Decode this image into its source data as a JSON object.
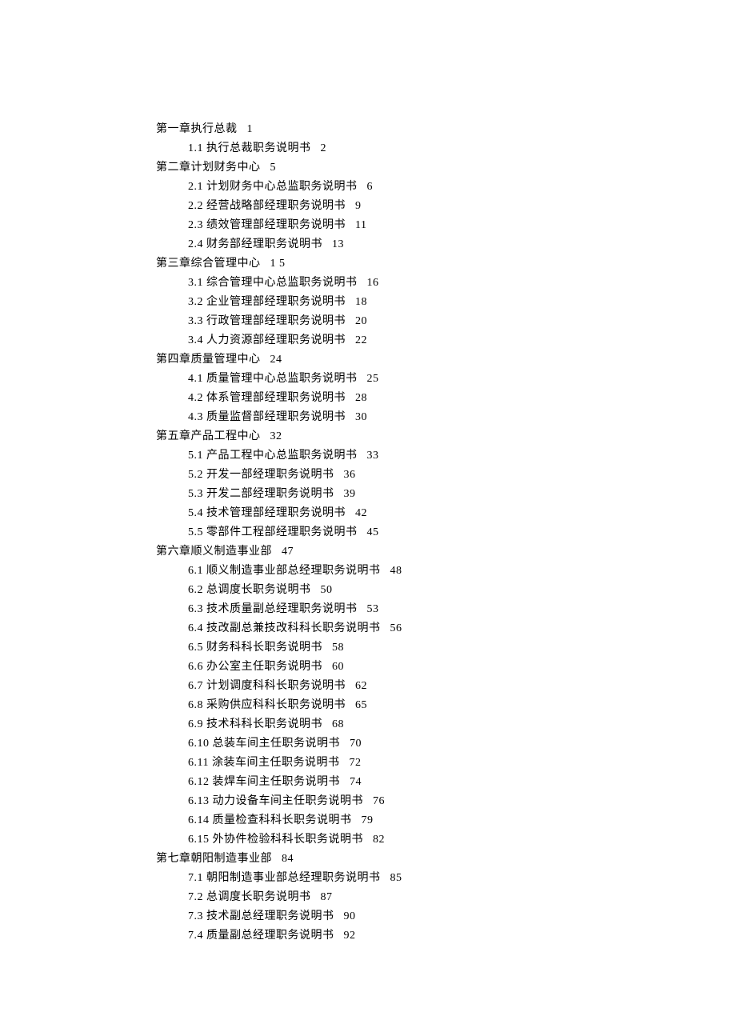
{
  "toc": [
    {
      "type": "chapter",
      "title": "第一章执行总裁",
      "page": "1"
    },
    {
      "type": "section",
      "num": "1.1",
      "title": "执行总裁职务说明书",
      "page": "2"
    },
    {
      "type": "chapter",
      "title": "第二章计划财务中心",
      "page": "5"
    },
    {
      "type": "section",
      "num": "2.1",
      "title": "计划财务中心总监职务说明书",
      "page": "6"
    },
    {
      "type": "section",
      "num": "2.2",
      "title": "经营战略部经理职务说明书",
      "page": "9"
    },
    {
      "type": "section",
      "num": "2.3",
      "title": "绩效管理部经理职务说明书",
      "page": "11"
    },
    {
      "type": "section",
      "num": "2.4",
      "title": "财务部经理职务说明书",
      "page": "13"
    },
    {
      "type": "chapter",
      "title": "第三章综合管理中心",
      "page": "1 5"
    },
    {
      "type": "section",
      "num": "3.1",
      "title": "综合管理中心总监职务说明书",
      "page": "16"
    },
    {
      "type": "section",
      "num": "3.2",
      "title": "企业管理部经理职务说明书",
      "page": "18"
    },
    {
      "type": "section",
      "num": "3.3",
      "title": "行政管理部经理职务说明书",
      "page": "20"
    },
    {
      "type": "section",
      "num": "3.4",
      "title": "人力资源部经理职务说明书",
      "page": "22"
    },
    {
      "type": "chapter",
      "title": "第四章质量管理中心",
      "page": "24"
    },
    {
      "type": "section",
      "num": "4.1",
      "title": "质量管理中心总监职务说明书",
      "page": "25"
    },
    {
      "type": "section",
      "num": "4.2",
      "title": "体系管理部经理职务说明书",
      "page": "28"
    },
    {
      "type": "section",
      "num": "4.3",
      "title": "质量监督部经理职务说明书",
      "page": "30"
    },
    {
      "type": "chapter",
      "title": "第五章产品工程中心",
      "page": "32"
    },
    {
      "type": "section",
      "num": "5.1",
      "title": "产品工程中心总监职务说明书",
      "page": "33"
    },
    {
      "type": "section",
      "num": "5.2",
      "title": "开发一部经理职务说明书",
      "page": "36"
    },
    {
      "type": "section",
      "num": "5.3",
      "title": "开发二部经理职务说明书",
      "page": "39"
    },
    {
      "type": "section",
      "num": "5.4",
      "title": "技术管理部经理职务说明书",
      "page": "42"
    },
    {
      "type": "section",
      "num": "5.5",
      "title": "零部件工程部经理职务说明书",
      "page": "45"
    },
    {
      "type": "chapter",
      "title": "第六章顺义制造事业部",
      "page": "47"
    },
    {
      "type": "section",
      "num": "6.1",
      "title": "顺义制造事业部总经理职务说明书",
      "page": "48"
    },
    {
      "type": "section",
      "num": "6.2",
      "title": "总调度长职务说明书",
      "page": "50"
    },
    {
      "type": "section",
      "num": "6.3",
      "title": "技术质量副总经理职务说明书",
      "page": "53"
    },
    {
      "type": "section",
      "num": "6.4",
      "title": "技改副总兼技改科科长职务说明书",
      "page": "56"
    },
    {
      "type": "section",
      "num": "6.5",
      "title": "财务科科长职务说明书",
      "page": "58"
    },
    {
      "type": "section",
      "num": "6.6",
      "title": "办公室主任职务说明书",
      "page": "60"
    },
    {
      "type": "section",
      "num": "6.7",
      "title": "计划调度科科长职务说明书",
      "page": "62"
    },
    {
      "type": "section",
      "num": "6.8",
      "title": "采购供应科科长职务说明书",
      "page": "65"
    },
    {
      "type": "section",
      "num": "6.9",
      "title": "技术科科长职务说明书",
      "page": "68"
    },
    {
      "type": "section",
      "num": "6.10",
      "title": "总装车间主任职务说明书",
      "page": "70"
    },
    {
      "type": "section",
      "num": "6.11",
      "title": "涂装车间主任职务说明书",
      "page": "72"
    },
    {
      "type": "section",
      "num": "6.12",
      "title": "装焊车间主任职务说明书",
      "page": "74"
    },
    {
      "type": "section",
      "num": "6.13",
      "title": "动力设备车间主任职务说明书",
      "page": "76"
    },
    {
      "type": "section",
      "num": "6.14",
      "title": "质量检查科科长职务说明书",
      "page": "79"
    },
    {
      "type": "section",
      "num": "6.15",
      "title": "外协件检验科科长职务说明书",
      "page": "82"
    },
    {
      "type": "chapter",
      "title": "第七章朝阳制造事业部",
      "page": "84"
    },
    {
      "type": "section",
      "num": "7.1",
      "title": "朝阳制造事业部总经理职务说明书",
      "page": "85"
    },
    {
      "type": "section",
      "num": "7.2",
      "title": "总调度长职务说明书",
      "page": "87"
    },
    {
      "type": "section",
      "num": "7.3",
      "title": "技术副总经理职务说明书",
      "page": "90"
    },
    {
      "type": "section",
      "num": "7.4",
      "title": "质量副总经理职务说明书",
      "page": "92"
    }
  ]
}
